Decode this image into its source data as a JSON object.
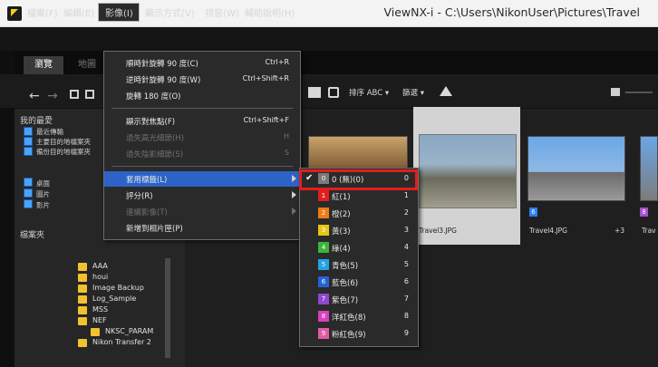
{
  "window": {
    "title": "ViewNX-i - C:\\Users\\NikonUser\\Pictures\\Travel"
  },
  "menubar": [
    "檔案(F)",
    "編輯(E)",
    "影像(I)",
    "顯示方式(V)",
    "視窗(W)",
    "輔助說明(H)"
  ],
  "tabs": [
    "瀏覽",
    "地圖"
  ],
  "toolbar": {
    "sort_label": "排序 ABC ▾",
    "filter_label": "篩選 ▾"
  },
  "sidebar": {
    "favorites_header": "我的最愛",
    "favorites": [
      "最近傳輸",
      "主要目的地檔案夾",
      "備份目的地檔案夾"
    ],
    "places": [
      "桌面",
      "圖片",
      "影片"
    ],
    "folders_header": "檔案夾",
    "folders": [
      "AAA",
      "houi",
      "Image Backup",
      "Log_Sample",
      "MSS",
      "NEF",
      "NKSC_PARAM",
      "Nikon Transfer 2"
    ]
  },
  "content": {
    "thumbs": [
      {
        "label": "Travel3.JPG"
      },
      {
        "label": "Travel4.JPG",
        "extra": "+3",
        "badge": "6"
      },
      {
        "label": "Trav",
        "badge": "8"
      }
    ]
  },
  "dropdown": {
    "items": [
      {
        "label": "順時針旋轉 90 度(C)",
        "shortcut": "Ctrl+R"
      },
      {
        "label": "逆時針旋轉 90 度(W)",
        "shortcut": "Ctrl+Shift+R"
      },
      {
        "label": "旋轉 180 度(O)",
        "shortcut": ""
      },
      {
        "label": "顯示對焦點(F)",
        "shortcut": "Ctrl+Shift+F"
      },
      {
        "label": "過失高光細節(H)",
        "shortcut": "H"
      },
      {
        "label": "過失陰影細節(S)",
        "shortcut": "S"
      },
      {
        "label": "套用標籤(L)",
        "shortcut": ""
      },
      {
        "label": "評分(R)",
        "shortcut": ""
      },
      {
        "label": "連續影像(T)",
        "shortcut": ""
      },
      {
        "label": "新增到相片匣(P)",
        "shortcut": ""
      }
    ]
  },
  "submenu": {
    "items": [
      {
        "label": "0 (無)(0)",
        "num": "0",
        "color": "#7a7a7a"
      },
      {
        "label": "紅(1)",
        "num": "1",
        "color": "#e21e1e"
      },
      {
        "label": "橙(2)",
        "num": "2",
        "color": "#f07a16"
      },
      {
        "label": "黃(3)",
        "num": "3",
        "color": "#e7c715"
      },
      {
        "label": "綠(4)",
        "num": "4",
        "color": "#3cb43b"
      },
      {
        "label": "青色(5)",
        "num": "5",
        "color": "#24a3e6"
      },
      {
        "label": "藍色(6)",
        "num": "6",
        "color": "#2563d3"
      },
      {
        "label": "紫色(7)",
        "num": "7",
        "color": "#8f47d0"
      },
      {
        "label": "洋紅色(8)",
        "num": "8",
        "color": "#d93fbd"
      },
      {
        "label": "粉紅色(9)",
        "num": "9",
        "color": "#e25aa5"
      }
    ],
    "swatch_text": [
      "0",
      "1",
      "2",
      "3",
      "4",
      "5",
      "6",
      "7",
      "8",
      "9"
    ]
  }
}
